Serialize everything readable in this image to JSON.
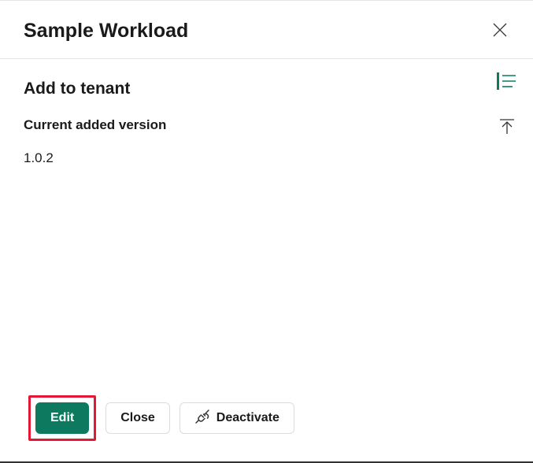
{
  "header": {
    "title": "Sample Workload"
  },
  "main": {
    "subtitle": "Add to tenant",
    "version_label": "Current added version",
    "version_value": "1.0.2"
  },
  "footer": {
    "edit_label": "Edit",
    "close_label": "Close",
    "deactivate_label": "Deactivate"
  },
  "colors": {
    "accent": "#0d7a5f",
    "highlight": "#e31836"
  }
}
